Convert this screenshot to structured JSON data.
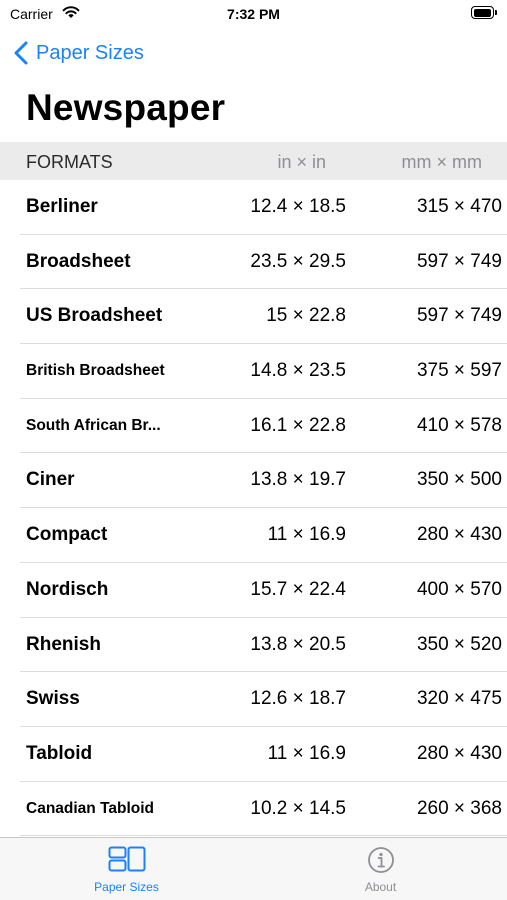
{
  "status_bar": {
    "carrier": "Carrier",
    "time": "7:32 PM"
  },
  "nav": {
    "back_label": "Paper Sizes"
  },
  "page": {
    "title": "Newspaper"
  },
  "table": {
    "headers": {
      "formats": "FORMATS",
      "inches": "in × in",
      "mm": "mm × mm"
    },
    "rows": [
      {
        "name": "Berliner",
        "in": "12.4 × 18.5",
        "mm": "315 × 470"
      },
      {
        "name": "Broadsheet",
        "in": "23.5 × 29.5",
        "mm": "597 × 749"
      },
      {
        "name": "US Broadsheet",
        "in": "15 × 22.8",
        "mm": "597 × 749"
      },
      {
        "name": "British Broadsheet",
        "in": "14.8 × 23.5",
        "mm": "375 × 597"
      },
      {
        "name": "South African Br...",
        "in": "16.1 × 22.8",
        "mm": "410 × 578"
      },
      {
        "name": "Ciner",
        "in": "13.8 × 19.7",
        "mm": "350 × 500"
      },
      {
        "name": "Compact",
        "in": "11 × 16.9",
        "mm": "280 × 430"
      },
      {
        "name": "Nordisch",
        "in": "15.7 × 22.4",
        "mm": "400 × 570"
      },
      {
        "name": "Rhenish",
        "in": "13.8 × 20.5",
        "mm": "350 × 520"
      },
      {
        "name": "Swiss",
        "in": "12.6 × 18.7",
        "mm": "320 × 475"
      },
      {
        "name": "Tabloid",
        "in": "11 × 16.9",
        "mm": "280 × 430"
      },
      {
        "name": "Canadian Tabloid",
        "in": "10.2 × 14.5",
        "mm": "260 × 368"
      }
    ]
  },
  "tab_bar": {
    "tabs": [
      {
        "label": "Paper Sizes",
        "icon": "paper-sizes-icon",
        "selected": true
      },
      {
        "label": "About",
        "icon": "info-icon",
        "selected": false
      }
    ]
  },
  "colors": {
    "accent": "#1a82f7",
    "header_bg": "#ebebeb",
    "inactive": "#8e8e93"
  }
}
